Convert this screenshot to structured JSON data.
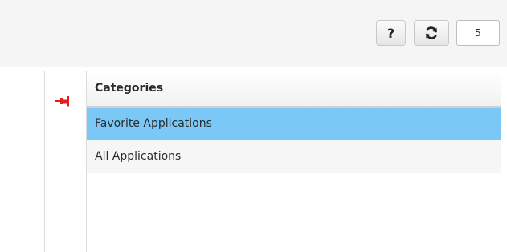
{
  "toolbar": {
    "help_label": "?",
    "count_value": "5"
  },
  "categories": {
    "header": "Categories",
    "rows": [
      {
        "label": "Favorite Applications",
        "selected": true
      },
      {
        "label": "All Applications",
        "selected": false
      }
    ]
  },
  "colors": {
    "selected_row": "#79c8f5",
    "pin": "#e02020"
  },
  "icons": {
    "refresh": "refresh-icon",
    "pin": "pin-icon"
  }
}
